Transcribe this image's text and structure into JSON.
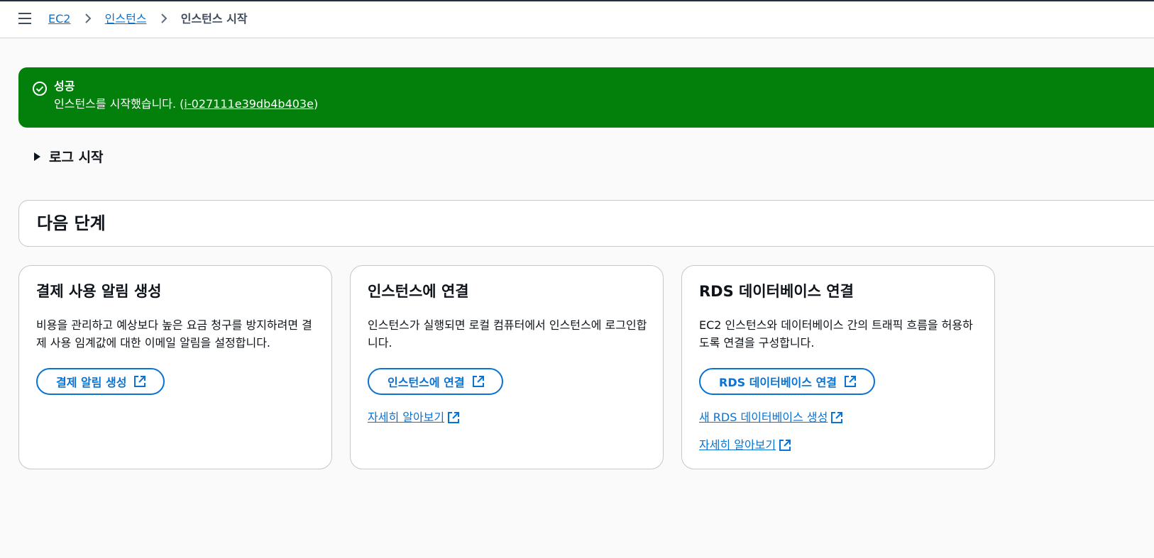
{
  "breadcrumb": {
    "items": [
      "EC2",
      "인스턴스"
    ],
    "current": "인스턴스 시작"
  },
  "flash": {
    "title": "성공",
    "message_prefix": "인스턴스를 시작했습니다. (",
    "instance_id": "i-027111e39db4b403e",
    "message_suffix": ")"
  },
  "launch_log": {
    "label": "로그 시작"
  },
  "next_steps": {
    "title": "다음 단계"
  },
  "cards": [
    {
      "title": "결제 사용 알림 생성",
      "description": "비용을 관리하고 예상보다 높은 요금 청구를 방지하려면 결제 사용 임계값에 대한 이메일 알림을 설정합니다.",
      "button": "결제 알림 생성",
      "links": []
    },
    {
      "title": "인스턴스에 연결",
      "description": "인스턴스가 실행되면 로컬 컴퓨터에서 인스턴스에 로그인합니다.",
      "button": "인스턴스에 연결",
      "links": [
        "자세히 알아보기"
      ]
    },
    {
      "title": "RDS 데이터베이스 연결",
      "description": "EC2 인스턴스와 데이터베이스 간의 트래픽 흐름을 허용하도록 연결을 구성합니다.",
      "button": "RDS 데이터베이스 연결",
      "links": [
        "새 RDS 데이터베이스 생성",
        "자세히 알아보기"
      ]
    }
  ],
  "icons": {
    "menu": "hamburger-menu-icon",
    "breadcrumb_separator": "chevron-right-icon",
    "success": "check-circle-icon",
    "expand": "caret-right-icon",
    "external": "external-link-icon"
  },
  "colors": {
    "success_bg": "#037f0c",
    "link": "#0972d3",
    "text": "#0f141a",
    "border": "#c6c6cd"
  }
}
